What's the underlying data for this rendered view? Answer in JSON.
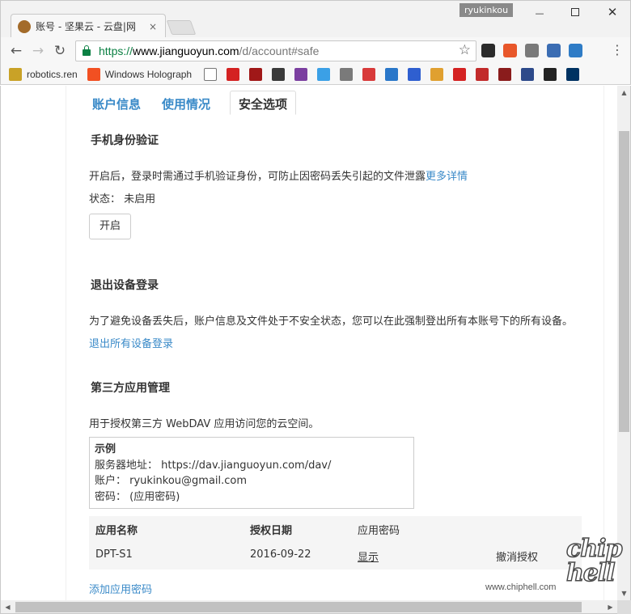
{
  "window": {
    "tab_title": "账号 - 坚果云 - 云盘|网",
    "tab_close": "×",
    "user": "ryukinkou",
    "minimize": "—",
    "maximize": "",
    "close": "✕"
  },
  "toolbar": {
    "back": "←",
    "forward": "→",
    "reload": "↻",
    "url_scheme": "https://",
    "url_host": "www.jianguoyun.com",
    "url_path": "/d/account#safe",
    "star": "☆",
    "menu": "⋮",
    "extensions": [
      {
        "icon": "camera-extension-icon",
        "color": "#2b2b2b"
      },
      {
        "icon": "red-extension-icon",
        "color": "#e8572a"
      },
      {
        "icon": "dice-extension-icon",
        "color": "#7a7a7a"
      },
      {
        "icon": "swirl-extension-icon",
        "color": "#3b6db3"
      },
      {
        "icon": "blue-square-extension-icon",
        "color": "#2f7cc6"
      }
    ]
  },
  "bookmarks": [
    {
      "label": "robotics.ren",
      "icon": "crest-icon",
      "color": "#c9a227"
    },
    {
      "label": "Windows Holograph",
      "icon": "windows-icon",
      "color": "#f25022"
    },
    {
      "label": "",
      "icon": "page-icon",
      "color": "#ffffff"
    },
    {
      "label": "",
      "icon": "red-circle-icon",
      "color": "#d42222"
    },
    {
      "label": "",
      "icon": "dq-icon",
      "color": "#a01818"
    },
    {
      "label": "",
      "icon": "pattern-icon",
      "color": "#3a3a3a"
    },
    {
      "label": "",
      "icon": "rainbow-icon",
      "color": "#7b3fa0"
    },
    {
      "label": "",
      "icon": "bird-icon",
      "color": "#3ba0e6"
    },
    {
      "label": "",
      "icon": "apple-icon",
      "color": "#7a7a7a"
    },
    {
      "label": "",
      "icon": "flag-icon",
      "color": "#d83a3a"
    },
    {
      "label": "",
      "icon": "puzzle-icon",
      "color": "#2a77c9"
    },
    {
      "label": "",
      "icon": "paw-icon",
      "color": "#2f5fd0"
    },
    {
      "label": "",
      "icon": "bone-icon",
      "color": "#e0a030"
    },
    {
      "label": "",
      "icon": "l-icon",
      "color": "#d42222"
    },
    {
      "label": "",
      "icon": "apple-red-icon",
      "color": "#c22b2b"
    },
    {
      "label": "",
      "icon": "mit-icon",
      "color": "#8a1c1c"
    },
    {
      "label": "",
      "icon": "shield-icon",
      "color": "#2d4a8a"
    },
    {
      "label": "",
      "icon": "r-icon",
      "color": "#222222"
    },
    {
      "label": "",
      "icon": "cal-icon",
      "color": "#003262"
    }
  ],
  "page": {
    "tabs": [
      {
        "label": "账户信息"
      },
      {
        "label": "使用情况"
      },
      {
        "label": "安全选项"
      }
    ],
    "mobile_verify": {
      "title": "手机身份验证",
      "desc": "开启后，登录时需通过手机验证身份，可防止因密码丢失引起的文件泄露",
      "more": "更多详情",
      "status_label": "状态：",
      "status_value": "未启用",
      "enable_button": "开启"
    },
    "logout_devices": {
      "title": "退出设备登录",
      "desc": "为了避免设备丢失后，账户信息及文件处于不安全状态，您可以在此强制登出所有本账号下的所有设备。",
      "action": "退出所有设备登录"
    },
    "third_party": {
      "title": "第三方应用管理",
      "desc": "用于授权第三方 WebDAV 应用访问您的云空间。",
      "example": {
        "title": "示例",
        "server": "服务器地址： https://dav.jianguoyun.com/dav/",
        "account": "账户： ryukinkou@gmail.com",
        "password": "密码： (应用密码)"
      },
      "table": {
        "headers": [
          "应用名称",
          "授权日期",
          "应用密码"
        ],
        "rows": [
          {
            "name": "DPT-S1",
            "date": "2016-09-22",
            "password_action": "显示",
            "revoke": "撤消授权"
          }
        ]
      },
      "add_password": "添加应用密码"
    }
  },
  "watermark": {
    "logo_top": "chip",
    "logo_bottom": "hell",
    "url": "www.chiphell.com"
  }
}
